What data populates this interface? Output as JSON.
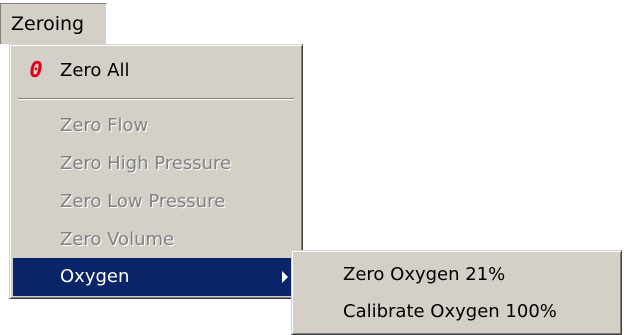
{
  "menubar": {
    "zeroing_label": "Zeroing"
  },
  "zeroing_menu": {
    "zero_all": {
      "icon_text": "0",
      "icon": "red-zero-icon",
      "label": "Zero All"
    },
    "items": [
      {
        "label": "Zero Flow",
        "enabled": false
      },
      {
        "label": "Zero High Pressure",
        "enabled": false
      },
      {
        "label": "Zero Low Pressure",
        "enabled": false
      },
      {
        "label": "Zero Volume",
        "enabled": false
      },
      {
        "label": "Oxygen",
        "enabled": true,
        "highlighted": true,
        "has_submenu": true
      }
    ]
  },
  "oxygen_submenu": {
    "items": [
      {
        "label": "Zero Oxygen 21%"
      },
      {
        "label": "Calibrate Oxygen 100%"
      }
    ]
  },
  "colors": {
    "menu_bg": "#d4d0c8",
    "highlight_bg": "#0a246a",
    "highlight_text": "#ffffff",
    "disabled_text": "#808080",
    "zero_icon": "#e0001b"
  }
}
